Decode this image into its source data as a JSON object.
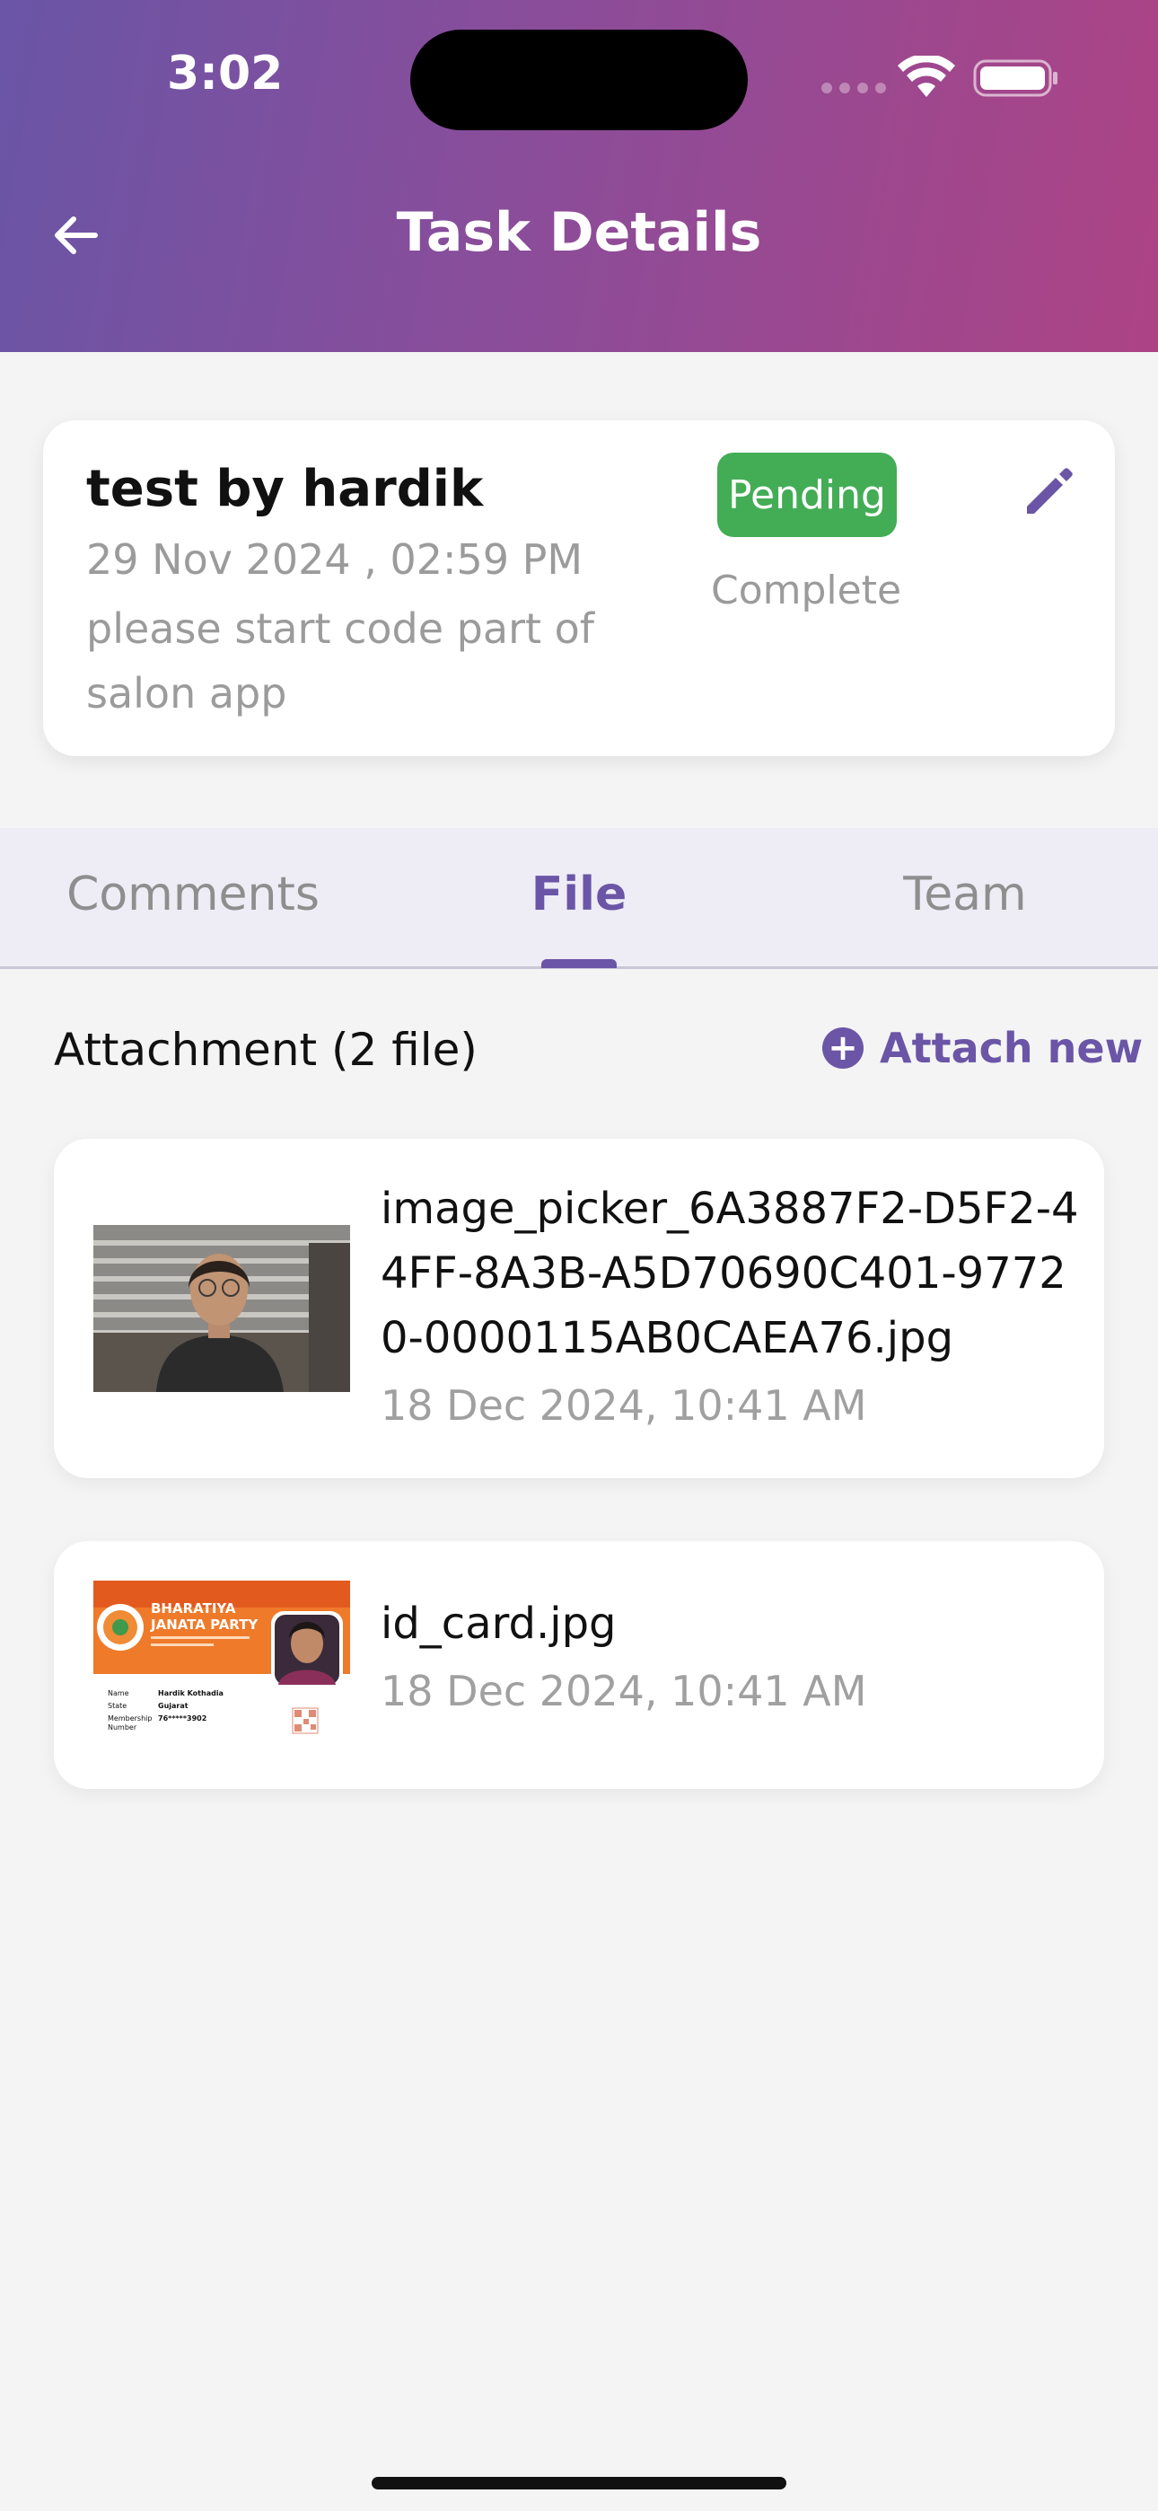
{
  "status_bar": {
    "time": "3:02",
    "icons": [
      "cellular-icon",
      "wifi-icon",
      "battery-icon"
    ]
  },
  "header": {
    "title": "Task Details",
    "back_icon": "arrow-left-icon"
  },
  "task": {
    "title": "test by hardik",
    "date": "29 Nov 2024 , 02:59 PM",
    "description": "please start code part of salon app",
    "status_selected": "Pending",
    "status_other": "Complete",
    "edit_icon": "pencil-icon"
  },
  "tabs": [
    {
      "label": "Comments"
    },
    {
      "label": "File",
      "active": true
    },
    {
      "label": "Team"
    }
  ],
  "attachments": {
    "heading": "Attachment (2 file)",
    "attach_new_label": "Attach new",
    "files": [
      {
        "name": "image_picker_6A3887F2-D5F2-44FF-8A3B-A5D70690C401-97720-0000115AB0CAEA76.jpg",
        "date": "18 Dec 2024, 10:41 AM"
      },
      {
        "name": "id_card.jpg",
        "date": "18 Dec 2024, 10:41 AM",
        "thumb_text": {
          "party_line1": "BHARATIYA",
          "party_line2": "JANATA PARTY",
          "field_name": "Name",
          "value_name": "Hardik Kothadia",
          "field_state": "State",
          "value_state": "Gujarat",
          "field_member1": "Membership",
          "field_member2": "Number",
          "value_member": "76*****3902"
        }
      }
    ]
  },
  "colors": {
    "accent": "#6a55a6",
    "header_gradient_start": "#6a55a6",
    "header_gradient_end": "#ad4385",
    "pending": "#43ad56"
  }
}
